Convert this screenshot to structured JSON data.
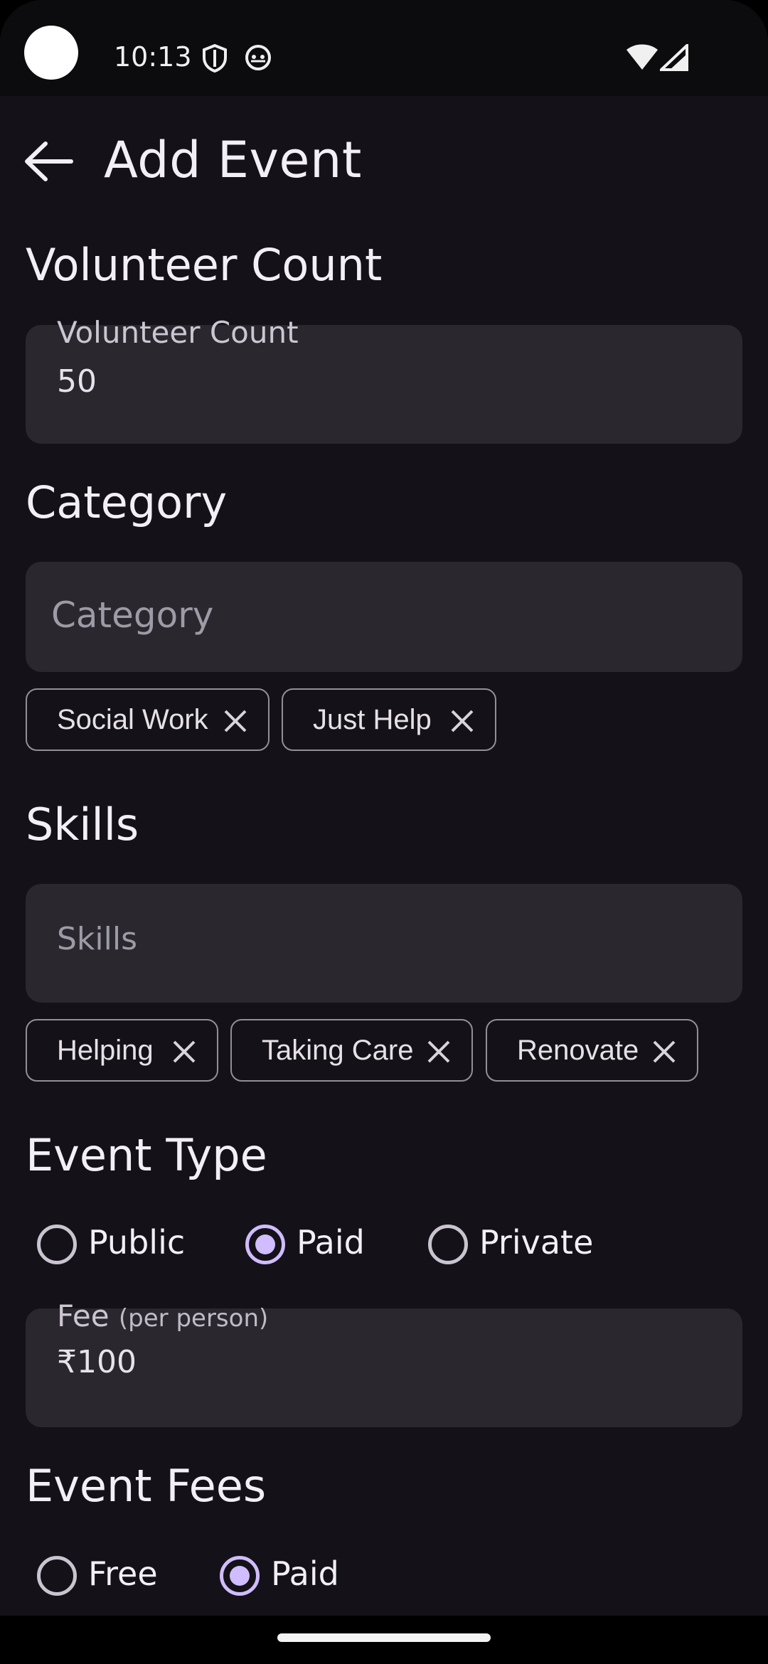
{
  "status_bar": {
    "time": "10:13"
  },
  "app_bar": {
    "title": "Add Event"
  },
  "volunteer": {
    "section_title": "Volunteer Count",
    "field_label": "Volunteer Count",
    "value": "50"
  },
  "category": {
    "section_title": "Category",
    "placeholder": "Category",
    "chips": [
      "Social Work",
      "Just Help"
    ]
  },
  "skills": {
    "section_title": "Skills",
    "placeholder": "Skills",
    "chips": [
      "Helping",
      "Taking Care",
      "Renovate"
    ]
  },
  "event_type": {
    "section_title": "Event Type",
    "options": [
      "Public",
      "Paid",
      "Private"
    ],
    "selected": "Paid"
  },
  "fee": {
    "label": "Fee",
    "label_suffix": "(per person)",
    "value": "₹100"
  },
  "event_fees": {
    "section_title": "Event Fees",
    "options": [
      "Free",
      "Paid"
    ],
    "selected": "Paid"
  },
  "colors": {
    "background": "#141218",
    "field": "#2a282e",
    "accent": "#d0bcff",
    "chip_border": "#938f99"
  }
}
